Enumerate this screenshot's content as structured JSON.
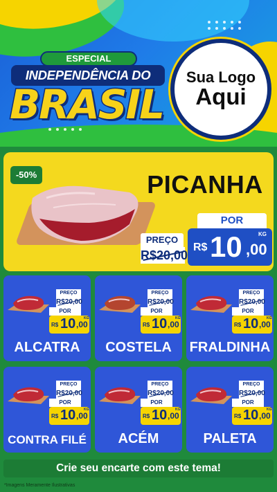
{
  "header": {
    "badge": "ESPECIAL",
    "title_line1": "INDEPENDÊNCIA DO",
    "title_line2": "BRASIL",
    "logo_line1": "Sua Logo",
    "logo_line2": "Aqui"
  },
  "hero": {
    "discount": "-50%",
    "name": "PICANHA",
    "preco_label": "PREÇO",
    "old_price": "R$20,00",
    "por_label": "POR",
    "currency": "R$",
    "price_int": "10",
    "price_dec": ",00",
    "unit": "KG"
  },
  "products": [
    {
      "name": "ALCATRA",
      "preco_label": "PREÇO",
      "old_price": "R$20,00",
      "por_label": "POR",
      "currency": "R$",
      "price_int": "10",
      "price_dec": ",00",
      "unit": "KG",
      "image": "steak-icon"
    },
    {
      "name": "COSTELA",
      "preco_label": "PREÇO",
      "old_price": "R$20,00",
      "por_label": "POR",
      "currency": "R$",
      "price_int": "10",
      "price_dec": ",00",
      "unit": "KG",
      "image": "ribs-icon"
    },
    {
      "name": "FRALDINHA",
      "preco_label": "PREÇO",
      "old_price": "R$20,00",
      "por_label": "POR",
      "currency": "R$",
      "price_int": "10",
      "price_dec": ",00",
      "unit": "KG",
      "image": "steak-icon"
    },
    {
      "name": "CONTRA FILÉ",
      "preco_label": "PREÇO",
      "old_price": "R$20,00",
      "por_label": "POR",
      "currency": "R$",
      "price_int": "10",
      "price_dec": ",00",
      "unit": "KG",
      "image": "steak-icon"
    },
    {
      "name": "ACÉM",
      "preco_label": "PREÇO",
      "old_price": "R$20,00",
      "por_label": "POR",
      "currency": "R$",
      "price_int": "10",
      "price_dec": ",00",
      "unit": "KG",
      "image": "steak-icon"
    },
    {
      "name": "PALETA",
      "preco_label": "PREÇO",
      "old_price": "R$20,00",
      "por_label": "POR",
      "currency": "R$",
      "price_int": "10",
      "price_dec": ",00",
      "unit": "KG",
      "image": "steak-icon"
    }
  ],
  "cta": "Crie seu encarte com este tema!",
  "disclaimer": "*Imagens Meramente Ilustrativas",
  "colors": {
    "green": "#1f8a3c",
    "yellow": "#f4d91e",
    "blue": "#2f56d8",
    "navy": "#0e2d7a"
  }
}
